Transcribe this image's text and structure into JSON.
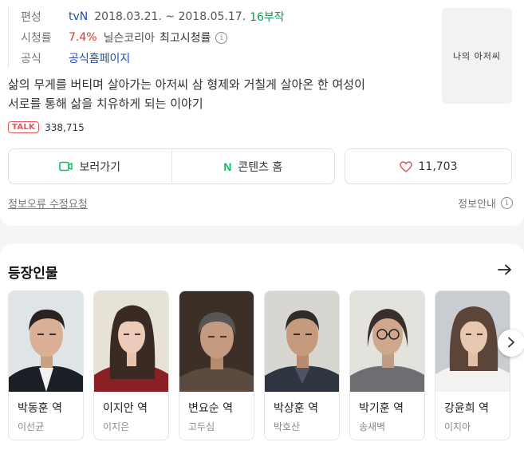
{
  "info": {
    "broadcast": {
      "label": "편성",
      "channel": "tvN",
      "period": "2018.03.21. ~ 2018.05.17.",
      "episodes": "16부작"
    },
    "rating": {
      "label": "시청률",
      "value": "7.4%",
      "source": "닐슨코리아",
      "type": "최고시청률"
    },
    "official": {
      "label": "공식",
      "link_text": "공식홈페이지"
    }
  },
  "poster": {
    "title_text": "나의 아저씨"
  },
  "synopsis": {
    "line1": "삶의 무게를 버티며 살아가는 아저씨 삼 형제와 거칠게 살아온 한 여성이",
    "line2": "서로를 통해 삶을 치유하게 되는 이야기"
  },
  "talk": {
    "badge": "TALK",
    "count": "338,715"
  },
  "actions": {
    "watch": "보러가기",
    "content_home": "콘텐츠 홈",
    "likes": "11,703"
  },
  "footer": {
    "correction": "정보오류 수정요청",
    "guide": "정보안내"
  },
  "cast_section": {
    "title": "등장인물",
    "members": [
      {
        "role": "박동훈 역",
        "actor": "이선균"
      },
      {
        "role": "이지안 역",
        "actor": "이지은"
      },
      {
        "role": "변요순 역",
        "actor": "고두심"
      },
      {
        "role": "박상훈 역",
        "actor": "박호산"
      },
      {
        "role": "박기훈 역",
        "actor": "송새벽"
      },
      {
        "role": "강윤희 역",
        "actor": "이지아"
      }
    ]
  },
  "colors": {
    "accent_green": "#03c75a",
    "rating_red": "#e0341e",
    "talk_red": "#e4555a",
    "link_blue": "#1d4cb5"
  }
}
